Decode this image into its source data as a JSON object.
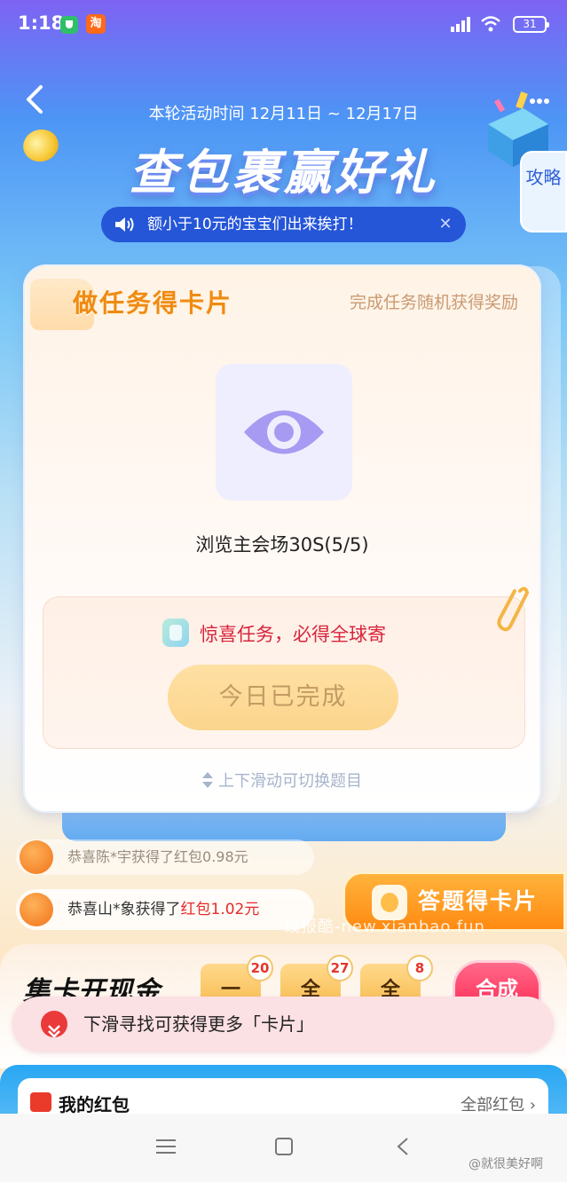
{
  "status_bar": {
    "time": "1:18",
    "taobao_badge": "淘",
    "battery": "31"
  },
  "header": {
    "activity_time": "本轮活动时间 12月11日 ~ 12月17日",
    "title": "查包裹赢好礼",
    "strategy_tab": "攻略",
    "notice": "额小于10元的宝宝们出来挨打！"
  },
  "task_card": {
    "title": "做任务得卡片",
    "subtitle": "完成任务随机获得奖励",
    "task_name": "浏览主会场30S(5/5)",
    "surprise_text": "惊喜任务，必得全球寄",
    "done_button": "今日已完成",
    "swipe_hint": "上下滑动可切换题目"
  },
  "ticker": [
    {
      "text_prefix": "恭喜陈*宇获得了",
      "highlight": "红包",
      "amount": "0.98元"
    },
    {
      "text_prefix": "恭喜山*象获得了",
      "highlight": "红包",
      "amount": "1.02元"
    }
  ],
  "quiz_button": "答题得卡片",
  "watermark": "线报酷-new.xianbao.fun",
  "collect": {
    "title": "集卡开现金",
    "chips": [
      {
        "label": "一",
        "count": "20"
      },
      {
        "label": "全",
        "count": "27"
      },
      {
        "label": "全",
        "count": "8"
      }
    ],
    "synth_button": "合成"
  },
  "scroll_hint": "下滑寻找可获得更多「卡片」",
  "red_packets": {
    "title": "我的红包",
    "all_link": "全部红包 ›"
  },
  "weibo_mark": "@就很美好啊",
  "colors": {
    "primary_blue": "#2556d8",
    "accent_orange": "#f08a12",
    "alert_red": "#e52a2a"
  }
}
